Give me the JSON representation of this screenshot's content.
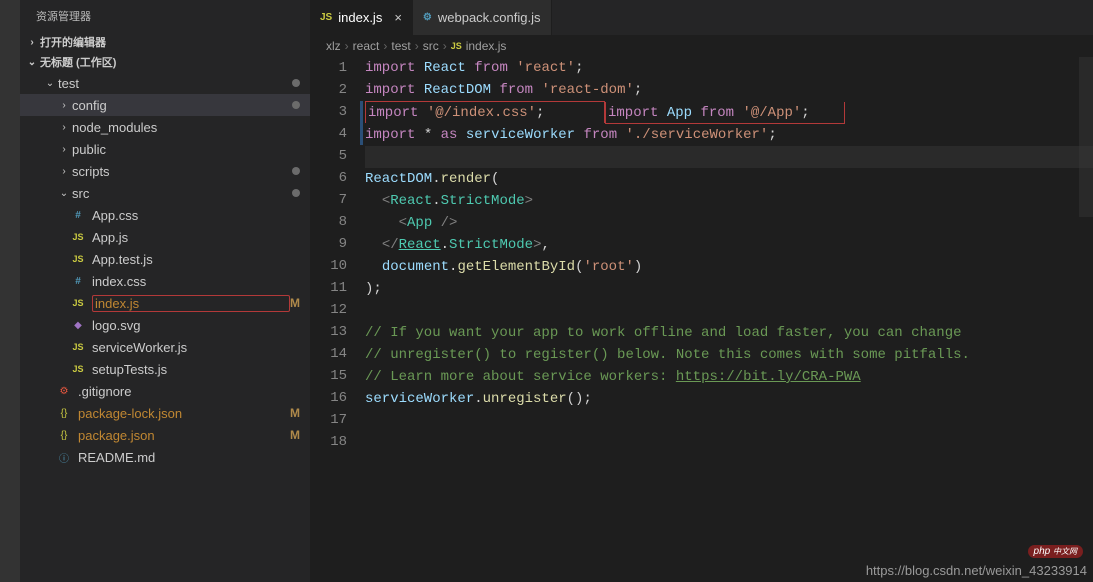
{
  "sidebar": {
    "title": "资源管理器",
    "sections": {
      "open_editors": "打开的编辑器",
      "workspace": "无标题 (工作区)"
    },
    "tree": [
      {
        "type": "folder",
        "name": "test",
        "depth": 1,
        "expanded": true,
        "dot": true
      },
      {
        "type": "folder",
        "name": "config",
        "depth": 2,
        "expanded": false,
        "active": true,
        "dot": true
      },
      {
        "type": "folder",
        "name": "node_modules",
        "depth": 2,
        "expanded": false
      },
      {
        "type": "folder",
        "name": "public",
        "depth": 2,
        "expanded": false
      },
      {
        "type": "folder",
        "name": "scripts",
        "depth": 2,
        "expanded": false,
        "dot": true
      },
      {
        "type": "folder",
        "name": "src",
        "depth": 2,
        "expanded": true,
        "dot": true
      },
      {
        "type": "file",
        "name": "App.css",
        "depth": 3,
        "icon": "css"
      },
      {
        "type": "file",
        "name": "App.js",
        "depth": 3,
        "icon": "js"
      },
      {
        "type": "file",
        "name": "App.test.js",
        "depth": 3,
        "icon": "js"
      },
      {
        "type": "file",
        "name": "index.css",
        "depth": 3,
        "icon": "css"
      },
      {
        "type": "file",
        "name": "index.js",
        "depth": 3,
        "icon": "js",
        "status": "M",
        "highlight": true,
        "modified": true
      },
      {
        "type": "file",
        "name": "logo.svg",
        "depth": 3,
        "icon": "svg"
      },
      {
        "type": "file",
        "name": "serviceWorker.js",
        "depth": 3,
        "icon": "js"
      },
      {
        "type": "file",
        "name": "setupTests.js",
        "depth": 3,
        "icon": "js"
      },
      {
        "type": "file",
        "name": ".gitignore",
        "depth": 2,
        "icon": "git"
      },
      {
        "type": "file",
        "name": "package-lock.json",
        "depth": 2,
        "icon": "json",
        "status": "M",
        "modified": true
      },
      {
        "type": "file",
        "name": "package.json",
        "depth": 2,
        "icon": "json",
        "status": "M",
        "modified": true
      },
      {
        "type": "file",
        "name": "README.md",
        "depth": 2,
        "icon": "md"
      }
    ]
  },
  "tabs": [
    {
      "label": "index.js",
      "icon": "js",
      "active": true,
      "dirty": false
    },
    {
      "label": "webpack.config.js",
      "icon": "cfg",
      "active": false
    }
  ],
  "breadcrumb": [
    "xlz",
    "react",
    "test",
    "src",
    "index.js"
  ],
  "breadcrumb_icon": "JS",
  "code": {
    "lines": [
      {
        "n": 1,
        "html": "<span class='tk-keyword'>import</span> <span class='tk-var'>React</span> <span class='tk-keyword'>from</span> <span class='tk-string'>'react'</span><span class='tk-punc'>;</span>"
      },
      {
        "n": 2,
        "html": "<span class='tk-keyword'>import</span> <span class='tk-var'>ReactDOM</span> <span class='tk-keyword'>from</span> <span class='tk-string'>'react-dom'</span><span class='tk-punc'>;</span>"
      },
      {
        "n": 3,
        "html": "<span class='tk-keyword'>import</span> <span class='tk-string'>'@/index.css'</span><span class='tk-punc'>;</span>",
        "boxed": true
      },
      {
        "n": 4,
        "html": "<span class='tk-keyword'>import</span> <span class='tk-var'>App</span> <span class='tk-keyword'>from</span> <span class='tk-string'>'@/App'</span><span class='tk-punc'>;</span>",
        "boxed": true
      },
      {
        "n": 5,
        "html": "<span class='tk-keyword'>import</span> <span class='tk-punc'>*</span> <span class='tk-keyword'>as</span> <span class='tk-var'>serviceWorker</span> <span class='tk-keyword'>from</span> <span class='tk-string'>'./serviceWorker'</span><span class='tk-punc'>;</span>"
      },
      {
        "n": 6,
        "html": "",
        "current": true
      },
      {
        "n": 7,
        "html": "<span class='tk-var'>ReactDOM</span><span class='tk-punc'>.</span><span class='tk-func'>render</span><span class='tk-punc'>(</span>"
      },
      {
        "n": 8,
        "html": "  <span class='tk-tag'>&lt;</span><span class='tk-component'>React</span><span class='tk-punc'>.</span><span class='tk-component'>StrictMode</span><span class='tk-tag'>&gt;</span>"
      },
      {
        "n": 9,
        "html": "    <span class='tk-tag'>&lt;</span><span class='tk-component'>App</span> <span class='tk-tag'>/&gt;</span>"
      },
      {
        "n": 10,
        "html": "  <span class='tk-tag'>&lt;/</span><span class='tk-component tk-underline'>React</span><span class='tk-punc'>.</span><span class='tk-component'>StrictMode</span><span class='tk-tag'>&gt;</span><span class='tk-punc'>,</span>"
      },
      {
        "n": 11,
        "html": "  <span class='tk-var'>document</span><span class='tk-punc'>.</span><span class='tk-func'>getElementById</span><span class='tk-punc'>(</span><span class='tk-string'>'root'</span><span class='tk-punc'>)</span>"
      },
      {
        "n": 12,
        "html": "<span class='tk-punc'>);</span>"
      },
      {
        "n": 13,
        "html": ""
      },
      {
        "n": 14,
        "html": "<span class='tk-comment'>// If you want your app to work offline and load faster, you can change</span>"
      },
      {
        "n": 15,
        "html": "<span class='tk-comment'>// unregister() to register() below. Note this comes with some pitfalls.</span>"
      },
      {
        "n": 16,
        "html": "<span class='tk-comment'>// Learn more about service workers: </span><span class='tk-link'>https://bit.ly/CRA-PWA</span>"
      },
      {
        "n": 17,
        "html": "<span class='tk-var'>serviceWorker</span><span class='tk-punc'>.</span><span class='tk-func'>unregister</span><span class='tk-punc'>();</span>"
      },
      {
        "n": 18,
        "html": ""
      }
    ]
  },
  "watermark": "https://blog.csdn.net/weixin_43233914",
  "badge_main": "php",
  "badge_sub": "中文网"
}
